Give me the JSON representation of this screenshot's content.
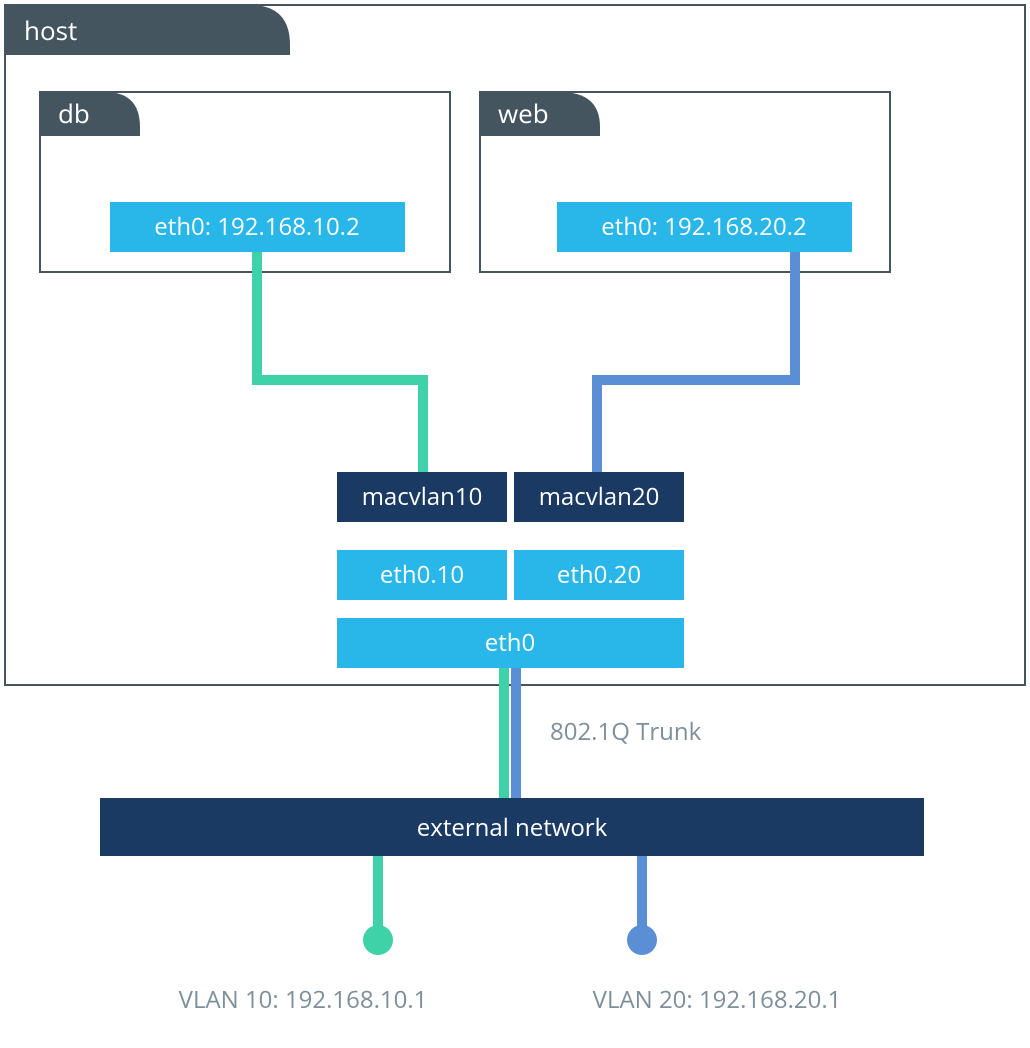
{
  "host": {
    "label": "host"
  },
  "containers": {
    "db": {
      "label": "db",
      "iface": "eth0: 192.168.10.2"
    },
    "web": {
      "label": "web",
      "iface": "eth0: 192.168.20.2"
    }
  },
  "macvlan": {
    "left": "macvlan10",
    "right": "macvlan20"
  },
  "subif": {
    "left": "eth0.10",
    "right": "eth0.20"
  },
  "physif": "eth0",
  "trunk_label": "802.1Q Trunk",
  "external_label": "external network",
  "vlans": {
    "left": "VLAN 10: 192.168.10.1",
    "right": "VLAN 20: 192.168.20.1"
  },
  "colors": {
    "green": "#3fd1a7",
    "blue": "#5a8fd6",
    "tab": "#445560",
    "iface": "#29b6e8",
    "dark": "#1b3a63"
  }
}
